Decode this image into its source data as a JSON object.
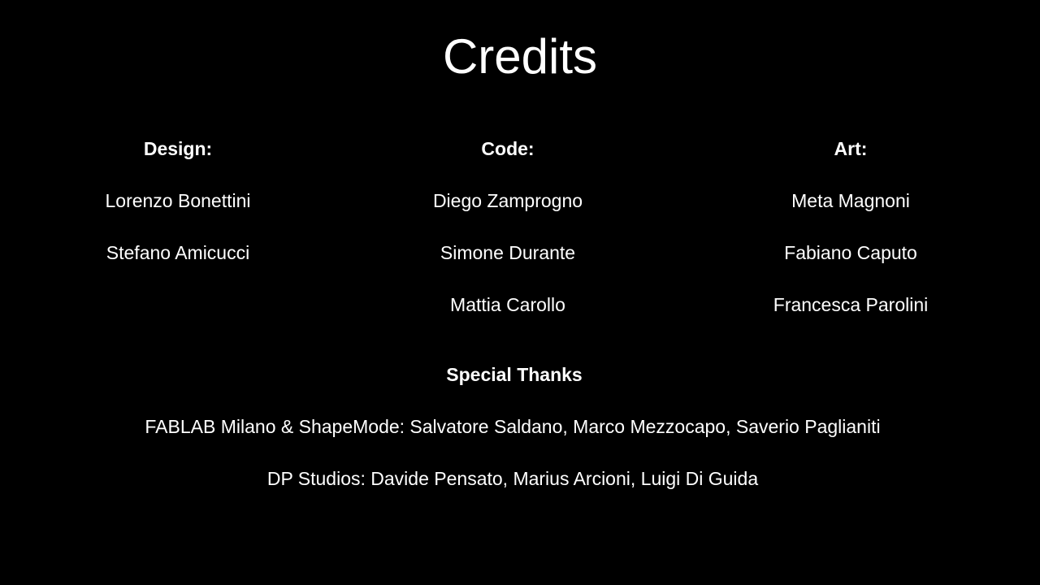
{
  "title": "Credits",
  "columns": {
    "design": {
      "heading": "Design:",
      "names": [
        "Lorenzo Bonettini",
        "Stefano Amicucci"
      ]
    },
    "code": {
      "heading": "Code:",
      "names": [
        "Diego Zamprogno",
        "Simone Durante",
        "Mattia Carollo"
      ]
    },
    "art": {
      "heading": "Art:",
      "names": [
        "Meta Magnoni",
        "Fabiano Caputo",
        "Francesca Parolini"
      ]
    }
  },
  "special_thanks": {
    "heading": "Special Thanks",
    "lines": [
      "FABLAB Milano & ShapeMode: Salvatore Saldano, Marco Mezzocapo, Saverio Paglianiti",
      "DP Studios: Davide Pensato, Marius Arcioni, Luigi Di Guida"
    ]
  }
}
